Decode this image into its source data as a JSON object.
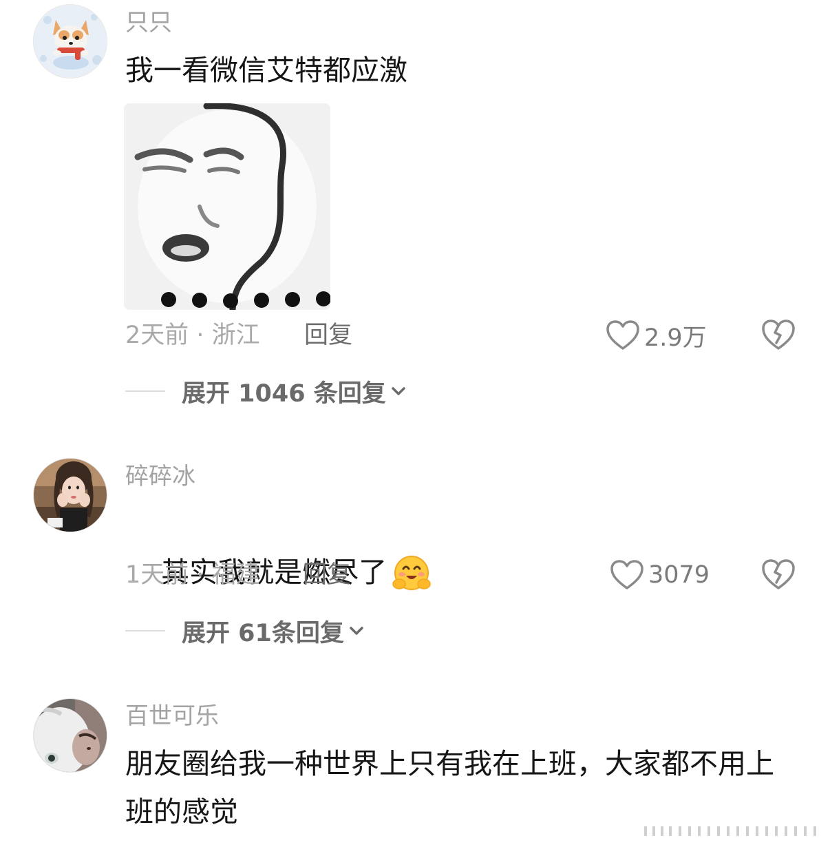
{
  "comments": [
    {
      "username": "只只",
      "text": "我一看微信艾特都应激",
      "time_location": "2天前 · 浙江",
      "reply_label": "回复",
      "like_count": "2.9万",
      "expand_label": "展开 1046 条回复",
      "avatar_icon": "dog-cartoon-avatar",
      "sticker": "meme-face-sticker"
    },
    {
      "username": "碎碎冰",
      "text": "其实我就是燃尽了",
      "emoji": "hugging-face-emoji",
      "time_location": "1天前 · 福建",
      "reply_label": "回复",
      "like_count": "3079",
      "expand_label": "展开 61条回复",
      "avatar_icon": "girl-photo-avatar"
    },
    {
      "username": "百世可乐",
      "text": "朋友圈给我一种世界上只有我在上班，大家都不用上班的感觉",
      "avatar_icon": "dog-photo-avatar"
    }
  ],
  "icons": {
    "like": "heart-outline-icon",
    "dislike": "broken-heart-icon",
    "expand": "chevron-down-icon"
  },
  "colors": {
    "username": "#a3a3a3",
    "content": "#161616",
    "meta": "#a9a9a9",
    "reply": "#6d6d6d",
    "icon": "#8a8a8a",
    "expand_text": "#6a6a6a"
  }
}
